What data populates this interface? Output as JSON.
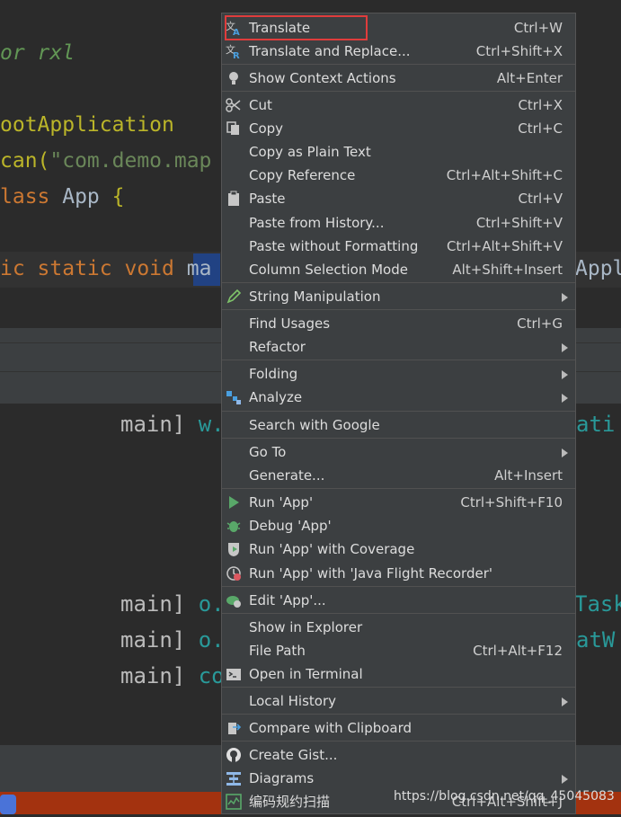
{
  "editor": {
    "lines": [
      {
        "parts": [
          {
            "t": "or",
            "c": "kw ital"
          },
          {
            "t": " rxl",
            "c": "ital"
          }
        ]
      },
      {
        "parts": [
          {
            "t": "ootApplication",
            "c": "ann"
          }
        ]
      },
      {
        "parts": [
          {
            "t": "can(",
            "c": "ann"
          },
          {
            "t": "\"com.demo.map",
            "c": "str"
          }
        ]
      },
      {
        "parts": [
          {
            "t": "lass",
            "c": "kw"
          },
          {
            "t": " App ",
            "c": ""
          },
          {
            "t": "{",
            "c": "ann"
          }
        ]
      },
      {
        "parts": [
          {
            "t": "ic static void ",
            "c": "kw"
          },
          {
            "t": "ma",
            "c": ""
          }
        ]
      }
    ],
    "right_fragment": "Appl"
  },
  "console": {
    "left": [
      "main] w.",
      "main] o.",
      "main] o.",
      "main] co"
    ],
    "right": [
      "ati",
      "Task",
      "atW"
    ]
  },
  "menu": {
    "items": [
      {
        "label": "Translate",
        "shortcut": "Ctrl+W",
        "icon": "translate-icon"
      },
      {
        "label": "Translate and Replace...",
        "shortcut": "Ctrl+Shift+X",
        "icon": "translate-replace-icon"
      },
      {
        "label": "Show Context Actions",
        "shortcut": "Alt+Enter",
        "icon": "bulb-icon"
      },
      {
        "label": "Cut",
        "shortcut": "Ctrl+X",
        "icon": "scissors-icon"
      },
      {
        "label": "Copy",
        "shortcut": "Ctrl+C",
        "icon": "copy-icon"
      },
      {
        "label": "Copy as Plain Text",
        "shortcut": ""
      },
      {
        "label": "Copy Reference",
        "shortcut": "Ctrl+Alt+Shift+C"
      },
      {
        "label": "Paste",
        "shortcut": "Ctrl+V",
        "icon": "paste-icon"
      },
      {
        "label": "Paste from History...",
        "shortcut": "Ctrl+Shift+V"
      },
      {
        "label": "Paste without Formatting",
        "shortcut": "Ctrl+Alt+Shift+V"
      },
      {
        "label": "Column Selection Mode",
        "shortcut": "Alt+Shift+Insert"
      },
      {
        "label": "String Manipulation",
        "shortcut": "",
        "icon": "pencil-icon",
        "submenu": true
      },
      {
        "label": "Find Usages",
        "shortcut": "Ctrl+G"
      },
      {
        "label": "Refactor",
        "shortcut": "",
        "submenu": true
      },
      {
        "label": "Folding",
        "shortcut": "",
        "submenu": true
      },
      {
        "label": "Analyze",
        "shortcut": "",
        "icon": "analyze-icon",
        "submenu": true
      },
      {
        "label": "Search with Google",
        "shortcut": ""
      },
      {
        "label": "Go To",
        "shortcut": "",
        "submenu": true
      },
      {
        "label": "Generate...",
        "shortcut": "Alt+Insert"
      },
      {
        "label": "Run 'App'",
        "shortcut": "Ctrl+Shift+F10",
        "icon": "run-icon"
      },
      {
        "label": "Debug 'App'",
        "shortcut": "",
        "icon": "debug-icon"
      },
      {
        "label": "Run 'App' with Coverage",
        "shortcut": "",
        "icon": "coverage-icon"
      },
      {
        "label": "Run 'App' with 'Java Flight Recorder'",
        "shortcut": "",
        "icon": "flight-recorder-icon"
      },
      {
        "label": "Edit 'App'...",
        "shortcut": "",
        "icon": "edit-config-icon"
      },
      {
        "label": "Show in Explorer",
        "shortcut": ""
      },
      {
        "label": "File Path",
        "shortcut": "Ctrl+Alt+F12"
      },
      {
        "label": "Open in Terminal",
        "shortcut": "",
        "icon": "terminal-icon"
      },
      {
        "label": "Local History",
        "shortcut": "",
        "submenu": true
      },
      {
        "label": "Compare with Clipboard",
        "shortcut": "",
        "icon": "compare-icon"
      },
      {
        "label": "Create Gist...",
        "shortcut": "",
        "icon": "github-icon"
      },
      {
        "label": "Diagrams",
        "shortcut": "",
        "icon": "diagram-icon",
        "submenu": true
      },
      {
        "label": "编码规约扫描",
        "shortcut": "Ctrl+Alt+Shift+J",
        "icon": "scan-icon"
      }
    ]
  },
  "watermark": "https://blog.csdn.net/qq_45045083"
}
